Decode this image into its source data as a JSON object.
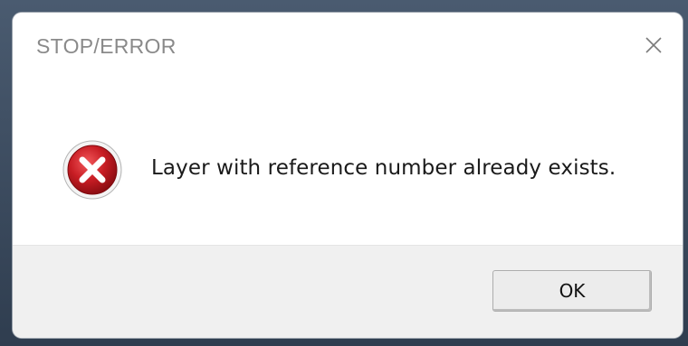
{
  "dialog": {
    "title": "STOP/ERROR",
    "message": "Layer with reference number already exists.",
    "icon": "error-x-icon",
    "close_icon": "close-icon",
    "buttons": {
      "ok_label": "OK"
    }
  },
  "colors": {
    "error_icon_fill": "#c0161d",
    "title_text": "#8a8a8a",
    "footer_background": "#f0f0f0"
  }
}
